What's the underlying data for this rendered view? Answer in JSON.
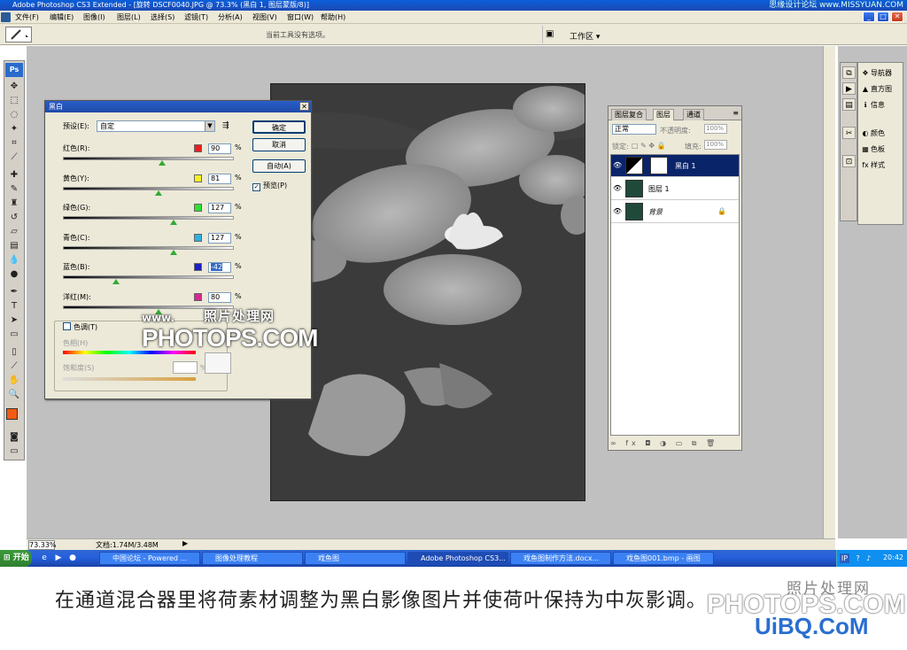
{
  "window": {
    "title": "Adobe Photoshop CS3 Extended - [旋转 DSCF0040.JPG @ 73.3% (黑白 1, 图层蒙版/8)]",
    "watermark": "思缘设计论坛 www.MISSYUAN.COM"
  },
  "menubar": [
    "文件(F)",
    "编辑(E)",
    "图像(I)",
    "图层(L)",
    "选择(S)",
    "滤镜(T)",
    "分析(A)",
    "视图(V)",
    "窗口(W)",
    "帮助(H)"
  ],
  "options_bar": {
    "hint": "当前工具没有选项。",
    "workspace": "工作区 ▾"
  },
  "toolbox": {
    "logo": "Ps"
  },
  "bw_dialog": {
    "title": "黑白",
    "preset_label": "预设(E):",
    "preset_value": "自定",
    "buttons": {
      "ok": "确定",
      "cancel": "取消",
      "auto": "自动(A)",
      "preview": "预览(P)"
    },
    "channels": [
      {
        "label": "红色(R):",
        "value": "90",
        "color": "#e8201c",
        "pos": 0.58
      },
      {
        "label": "黄色(Y):",
        "value": "81",
        "color": "#f8f020",
        "pos": 0.56
      },
      {
        "label": "绿色(G):",
        "value": "127",
        "color": "#30e030",
        "pos": 0.65
      },
      {
        "label": "青色(C):",
        "value": "127",
        "color": "#30b0e0",
        "pos": 0.65
      },
      {
        "label": "蓝色(B):",
        "value": "-42",
        "color": "#1a20c8",
        "pos": 0.31
      },
      {
        "label": "洋红(M):",
        "value": "80",
        "color": "#d82890",
        "pos": 0.56
      }
    ],
    "percent": "%",
    "tint_label": "色调(T)",
    "hue_label": "色相(H)",
    "saturation_label": "饱和度(S)",
    "saturation_unit": "%"
  },
  "watermark_overlay": {
    "www": "www.",
    "cn": "照片处理网",
    "en": "PHOTOPS.COM"
  },
  "status_bar": {
    "zoom": "73.33%",
    "doc": "文档:1.74M/3.48M"
  },
  "dock_panels": [
    {
      "icon": "❖",
      "label": "导航器"
    },
    {
      "icon": "▲",
      "label": "直方图"
    },
    {
      "icon": "ℹ",
      "label": "信息"
    },
    {
      "icon": "◐",
      "label": "颜色"
    },
    {
      "icon": "▦",
      "label": "色板"
    },
    {
      "icon": "fx",
      "label": "样式"
    }
  ],
  "layers_panel": {
    "tabs": [
      "图层复合",
      "图层",
      "通道"
    ],
    "blend_mode": "正常",
    "opacity_label": "不透明度:",
    "opacity_value": "100%",
    "lock_label": "锁定:",
    "fill_label": "填充:",
    "fill_value": "100%",
    "layers": [
      {
        "name": "黑白 1",
        "selected": true
      },
      {
        "name": "图层 1",
        "selected": false
      },
      {
        "name": "背景",
        "selected": false
      }
    ]
  },
  "taskbar": {
    "start": "开始",
    "tasks": [
      "中国论坛 - Powered ...",
      "图像处理教程",
      "戏鱼图",
      "Adobe Photoshop CS3...",
      "戏鱼图制作方法.docx...",
      "戏鱼图001.bmp - 画图"
    ],
    "tray_ime": "IP",
    "time": "20:42"
  },
  "caption": {
    "text": "在通道混合器里将荷素材调整为黑白影像图片并使荷叶保持为中灰影调。",
    "wm1": "照片处理网",
    "wm2": "PHOTOPS.COM",
    "wm3": "UiBQ.CoM"
  }
}
